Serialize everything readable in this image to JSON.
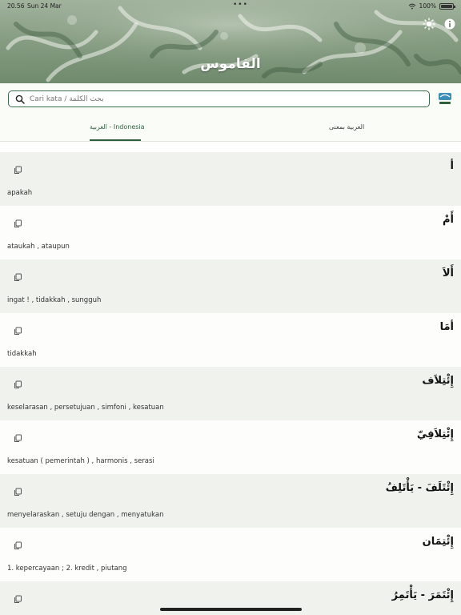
{
  "status": {
    "time": "20.56",
    "date": "Sun 24 Mar",
    "battery": "100%"
  },
  "header": {
    "title": "القاموس"
  },
  "search": {
    "placeholder": "Cari kata / بحث الكلمة"
  },
  "tabs": [
    {
      "label": "العربية - Indonesia",
      "active": true
    },
    {
      "label": "العربية بمعنى",
      "active": false
    }
  ],
  "entries": [
    {
      "arabic": "أ",
      "meaning": "apakah"
    },
    {
      "arabic": "أَمْ",
      "meaning": "ataukah , ataupun"
    },
    {
      "arabic": "أَلاَ",
      "meaning": "ingat ! , tidakkah , sungguh"
    },
    {
      "arabic": "أمَا",
      "meaning": "tidakkah"
    },
    {
      "arabic": "إِئْتِلاَف",
      "meaning": "keselarasan , persetujuan , simfoni , kesatuan"
    },
    {
      "arabic": "إِئْتِلاَفِيّ",
      "meaning": "kesatuan ( pemerintah ) , harmonis , serasi"
    },
    {
      "arabic": "إِئْتَلَفَ - يَأْتَلِفُ",
      "meaning": "menyelaraskan , setuju dengan , menyatukan"
    },
    {
      "arabic": "إِئْتِمَان",
      "meaning": "1. kepercayaan ; 2. kredit , piutang"
    },
    {
      "arabic": "إِئْتَمَرَ - يَأْتَمِرُ",
      "meaning": ""
    }
  ],
  "colors": {
    "accent": "#2e5e3c",
    "row_alt": "#f0f2ed"
  },
  "icons": {
    "search": "search-icon",
    "copy": "copy-icon",
    "brightness": "brightness-icon",
    "info": "info-icon"
  }
}
